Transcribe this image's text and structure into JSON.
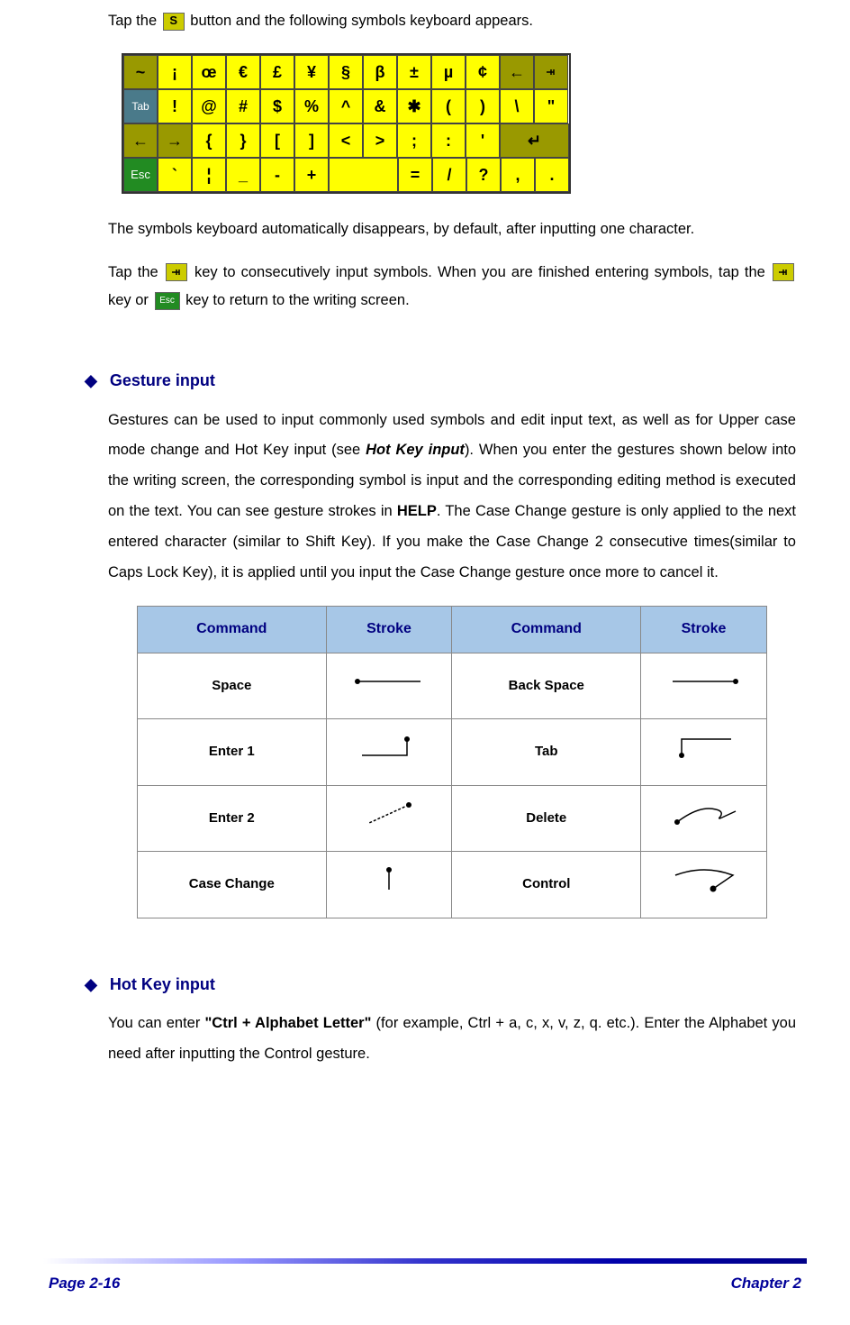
{
  "intro": {
    "text1": "Tap the ",
    "text2": " button and the following symbols keyboard appears."
  },
  "keyboard": {
    "rows": [
      [
        "~",
        "¡",
        "œ",
        "€",
        "£",
        "¥",
        "§",
        "β",
        "±",
        "µ",
        "¢",
        "←",
        "⇥"
      ],
      [
        "Tab",
        "!",
        "@",
        "#",
        "$",
        "%",
        "^",
        "&",
        "✱",
        "(",
        ")",
        "\\",
        "\""
      ],
      [
        "←",
        "→",
        "{",
        "}",
        "[",
        "]",
        "<",
        ">",
        ";",
        ":",
        "'",
        "↵"
      ],
      [
        "Esc",
        "`",
        "¦",
        "_",
        "-",
        "+",
        "",
        "=",
        "/",
        "?",
        ",",
        "."
      ]
    ]
  },
  "para1_a": "The symbols keyboard automatically disappears, by default, after inputting one character.",
  "para2_a": "Tap the ",
  "para2_b": " key to consecutively input symbols. When you are finished entering symbols, tap the ",
  "para2_c": " key or ",
  "para2_d": " key to return to the writing screen.",
  "section1": {
    "title": "Gesture input",
    "body_a": "Gestures can be used to input commonly used symbols and edit input text, as well as for Upper case mode change and Hot Key input (see ",
    "body_b": "Hot Key input",
    "body_c": "). When you enter the gestures shown below into the writing screen, the corresponding symbol is input and the corresponding editing method is executed on the text. You can see gesture strokes in ",
    "body_d": "HELP",
    "body_e": ". The Case Change gesture is only applied to the next entered character (similar to Shift Key). If you make the Case Change 2 consecutive times(similar to Caps Lock Key), it is applied until you input the Case Change gesture once more to cancel it."
  },
  "table": {
    "headers": [
      "Command",
      "Stroke",
      "Command",
      "Stroke"
    ],
    "rows": [
      {
        "c1": "Space",
        "c2": "Back Space"
      },
      {
        "c1": "Enter 1",
        "c2": "Tab"
      },
      {
        "c1": "Enter 2",
        "c2": "Delete"
      },
      {
        "c1": "Case Change",
        "c2": "Control"
      }
    ]
  },
  "section2": {
    "title": "Hot Key input",
    "body_a": "You can enter ",
    "body_b": "\"Ctrl + Alphabet Letter\"",
    "body_c": " (for example, Ctrl + a, c, x, v, z, q. etc.). Enter the Alphabet you need after inputting the Control gesture."
  },
  "footer": {
    "left": "Page 2-16",
    "right": "Chapter 2"
  }
}
